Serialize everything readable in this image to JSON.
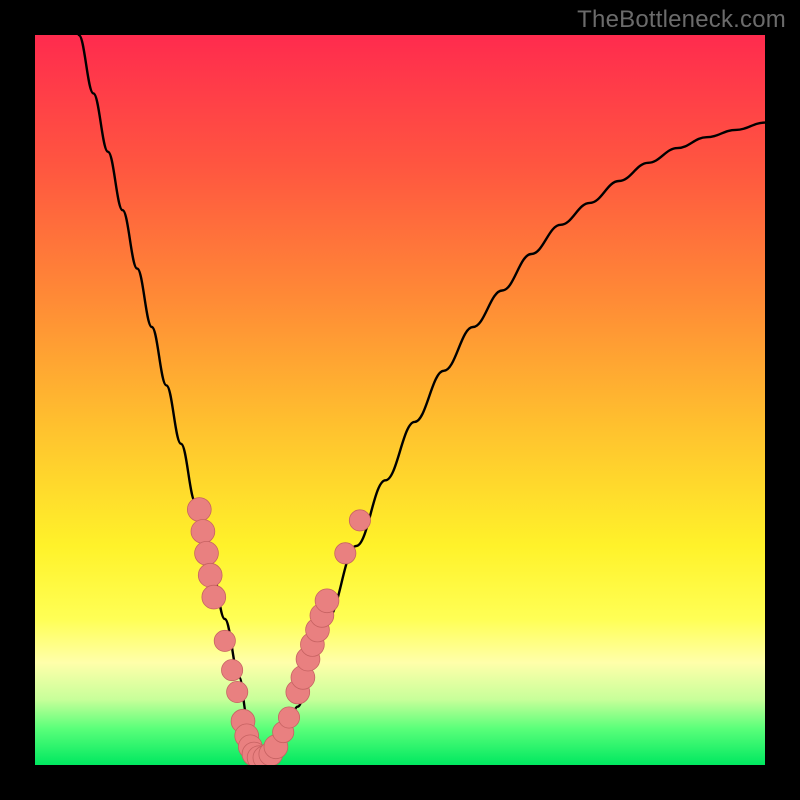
{
  "watermark": "TheBottleneck.com",
  "colors": {
    "frame": "#000000",
    "curve": "#000000",
    "marker_fill": "#e98080",
    "marker_stroke": "#c76262",
    "gradient_stops": [
      "#ff2b4e",
      "#ff5640",
      "#ff8a36",
      "#ffc22e",
      "#fff22a",
      "#ffff55",
      "#ffffaa",
      "#c8ff9a",
      "#5aff7a",
      "#00e860"
    ]
  },
  "chart_data": {
    "type": "line",
    "title": "",
    "xlabel": "",
    "ylabel": "",
    "xlim": [
      0,
      100
    ],
    "ylim": [
      0,
      100
    ],
    "legend": false,
    "grid": false,
    "series": [
      {
        "name": "bottleneck-curve",
        "x": [
          6,
          8,
          10,
          12,
          14,
          16,
          18,
          20,
          22,
          24,
          26,
          28,
          29,
          30,
          31,
          32,
          34,
          36,
          38,
          40,
          44,
          48,
          52,
          56,
          60,
          64,
          68,
          72,
          76,
          80,
          84,
          88,
          92,
          96,
          100
        ],
        "y": [
          100,
          92,
          84,
          76,
          68,
          60,
          52,
          44,
          36,
          28,
          20,
          12,
          7,
          3,
          1,
          1,
          3,
          8,
          14,
          20,
          30,
          39,
          47,
          54,
          60,
          65,
          70,
          74,
          77,
          80,
          82.5,
          84.5,
          86,
          87,
          88
        ]
      }
    ],
    "markers": [
      {
        "x": 22.5,
        "y": 35,
        "r": 1.2
      },
      {
        "x": 23.0,
        "y": 32,
        "r": 1.2
      },
      {
        "x": 23.5,
        "y": 29,
        "r": 1.2
      },
      {
        "x": 24.0,
        "y": 26,
        "r": 1.2
      },
      {
        "x": 24.5,
        "y": 23,
        "r": 1.2
      },
      {
        "x": 26.0,
        "y": 17,
        "r": 1.0
      },
      {
        "x": 27.0,
        "y": 13,
        "r": 1.0
      },
      {
        "x": 27.7,
        "y": 10,
        "r": 1.0
      },
      {
        "x": 28.5,
        "y": 6,
        "r": 1.2
      },
      {
        "x": 29.0,
        "y": 4,
        "r": 1.2
      },
      {
        "x": 29.5,
        "y": 2.5,
        "r": 1.2
      },
      {
        "x": 30.0,
        "y": 1.5,
        "r": 1.2
      },
      {
        "x": 30.7,
        "y": 1.0,
        "r": 1.2
      },
      {
        "x": 31.5,
        "y": 1.0,
        "r": 1.2
      },
      {
        "x": 32.3,
        "y": 1.5,
        "r": 1.2
      },
      {
        "x": 33.0,
        "y": 2.5,
        "r": 1.2
      },
      {
        "x": 34.0,
        "y": 4.5,
        "r": 1.0
      },
      {
        "x": 34.8,
        "y": 6.5,
        "r": 1.0
      },
      {
        "x": 36.0,
        "y": 10,
        "r": 1.2
      },
      {
        "x": 36.7,
        "y": 12,
        "r": 1.2
      },
      {
        "x": 37.4,
        "y": 14.5,
        "r": 1.2
      },
      {
        "x": 38.0,
        "y": 16.5,
        "r": 1.2
      },
      {
        "x": 38.7,
        "y": 18.5,
        "r": 1.2
      },
      {
        "x": 39.3,
        "y": 20.5,
        "r": 1.2
      },
      {
        "x": 40.0,
        "y": 22.5,
        "r": 1.2
      },
      {
        "x": 42.5,
        "y": 29,
        "r": 1.0
      },
      {
        "x": 44.5,
        "y": 33.5,
        "r": 1.0
      }
    ]
  }
}
